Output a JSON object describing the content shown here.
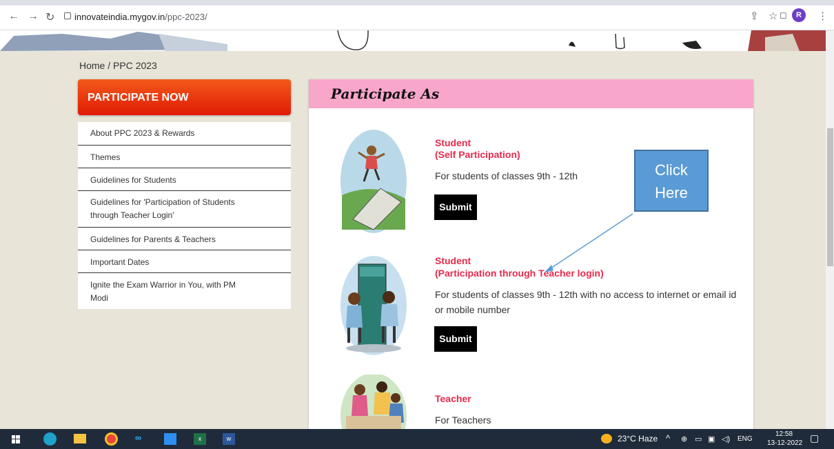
{
  "browser": {
    "url_host": "innovateindia.mygov.in",
    "url_path": "/ppc-2023/",
    "avatar_letter": "R"
  },
  "breadcrumb": "Home  /  PPC 2023",
  "sidebar": {
    "participate_label": "PARTICIPATE NOW",
    "items": [
      {
        "label": "About PPC 2023 & Rewards"
      },
      {
        "label": "Themes"
      },
      {
        "label": "Guidelines for Students"
      },
      {
        "label": "Guidelines for 'Participation of Students through Teacher Login'"
      },
      {
        "label": "Guidelines for Parents & Teachers"
      },
      {
        "label": "Important Dates"
      },
      {
        "label": "Ignite the Exam Warrior in You, with PM Modi"
      }
    ]
  },
  "main": {
    "heading": "Participate As",
    "options": [
      {
        "title_line1": "Student",
        "title_line2": "(Self Participation)",
        "description": "For students of classes 9th - 12th",
        "button": "Submit"
      },
      {
        "title_line1": "Student",
        "title_line2": "(Participation through Teacher login)",
        "description": "For students of classes 9th - 12th with no access to internet or email id or mobile number",
        "button": "Submit"
      },
      {
        "title_line1": "Teacher",
        "title_line2": "",
        "description": "For Teachers",
        "button": ""
      }
    ]
  },
  "annotation": {
    "line1": "Click",
    "line2": "Here"
  },
  "taskbar": {
    "weather": "23°C  Haze",
    "language": "ENG",
    "time": "12:58",
    "date": "13-12-2022"
  },
  "colors": {
    "accent_red": "#e8294c",
    "header_pink": "#f9a6cb",
    "callout_blue": "#5b9bd5",
    "page_bg": "#e8e4d8"
  }
}
